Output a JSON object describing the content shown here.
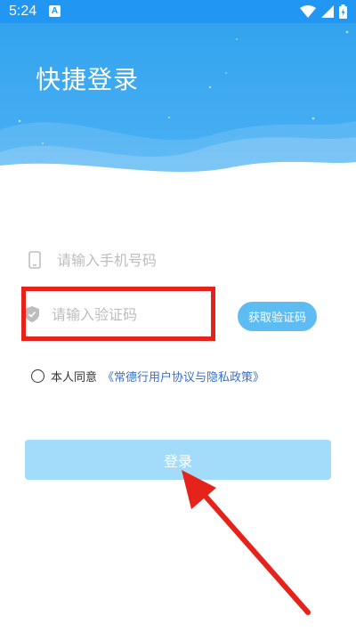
{
  "status_bar": {
    "time": "5:24",
    "notification_glyph": "A",
    "icons": [
      "wifi-icon",
      "signal-icon",
      "battery-icon"
    ]
  },
  "header": {
    "title": "快捷登录"
  },
  "form": {
    "phone": {
      "placeholder": "请输入手机号码",
      "icon": "phone-icon"
    },
    "code": {
      "placeholder": "请输入验证码",
      "icon": "shield-icon"
    },
    "get_code_label": "获取验证码"
  },
  "agreement": {
    "prefix": "本人同意",
    "link": "《常德行用户协议与隐私政策》",
    "checked": false
  },
  "login_label": "登录",
  "colors": {
    "status_bar": "#2196F3",
    "header": "#3fabf1",
    "accent_button": "#5dbdf3",
    "login_button": "#a3dcfa",
    "link": "#3b6fc4",
    "annotation": "#e5231b"
  }
}
